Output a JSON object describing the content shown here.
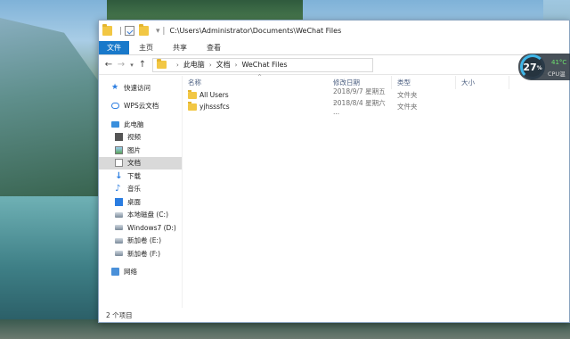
{
  "titlebar": {
    "path": "C:\\Users\\Administrator\\Documents\\WeChat Files"
  },
  "ribbon": {
    "tabs": [
      "文件",
      "主页",
      "共享",
      "查看"
    ]
  },
  "address": {
    "crumbs": [
      "此电脑",
      "文档",
      "WeChat Files"
    ]
  },
  "sidebar": {
    "items": [
      {
        "label": "快速访问",
        "icon": "star-icon"
      },
      {
        "label": "WPS云文档",
        "icon": "cloud-icon"
      },
      {
        "label": "此电脑",
        "icon": "computer-icon"
      },
      {
        "label": "视频",
        "icon": "video-icon"
      },
      {
        "label": "图片",
        "icon": "picture-icon"
      },
      {
        "label": "文档",
        "icon": "document-icon"
      },
      {
        "label": "下载",
        "icon": "download-icon"
      },
      {
        "label": "音乐",
        "icon": "music-icon"
      },
      {
        "label": "桌面",
        "icon": "desktop-icon"
      },
      {
        "label": "本地磁盘 (C:)",
        "icon": "drive-icon"
      },
      {
        "label": "Windows7 (D:)",
        "icon": "drive-icon"
      },
      {
        "label": "新加卷 (E:)",
        "icon": "drive-icon"
      },
      {
        "label": "新加卷 (F:)",
        "icon": "drive-icon"
      },
      {
        "label": "网络",
        "icon": "network-icon"
      }
    ]
  },
  "columns": {
    "name": "名称",
    "date": "修改日期",
    "type": "类型",
    "size": "大小"
  },
  "files": [
    {
      "name": "All Users",
      "date": "2018/9/7 星期五 ...",
      "type": "文件夹"
    },
    {
      "name": "yjhsssfcs",
      "date": "2018/8/4 星期六 ...",
      "type": "文件夹"
    }
  ],
  "status": {
    "count": "2 个项目"
  },
  "perf": {
    "percent": "27",
    "percent_sign": "%",
    "temp": "41°C",
    "label": "CPU温"
  },
  "colors": {
    "accent": "#1979ca",
    "selected": "#d9d9d9",
    "folder": "#f2c744"
  }
}
